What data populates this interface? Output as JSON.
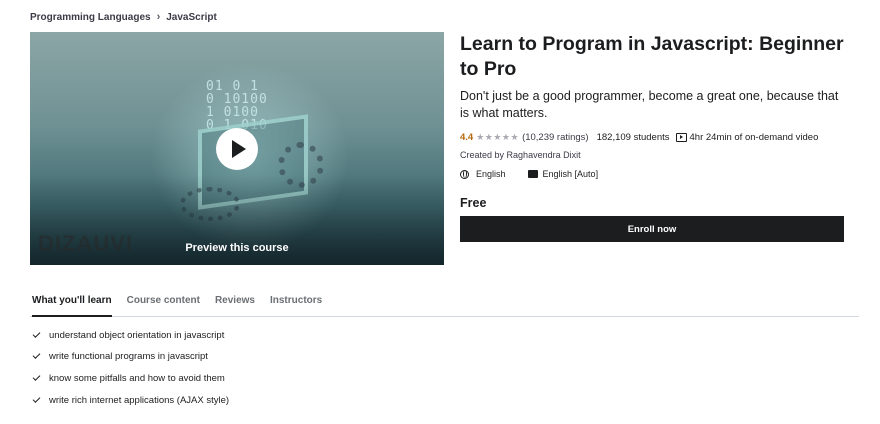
{
  "breadcrumb": {
    "items": [
      "Programming Languages",
      "JavaScript"
    ],
    "separator": "›"
  },
  "preview": {
    "caption": "Preview this course",
    "watermark": "DIZAUVI",
    "code_bits": [
      "01 0 1",
      "0 10100",
      "1 0100",
      "0 1 010"
    ]
  },
  "course": {
    "title": "Learn to Program in Javascript: Beginner to Pro",
    "subtitle": "Don't just be a good programmer, become a great one, because that is what matters.",
    "rating": "4.4",
    "stars": "★★★★★",
    "rating_count": "(10,239 ratings)",
    "students": "182,109 students",
    "duration": "4hr 24min of on-demand video",
    "created_by_prefix": "Created by",
    "instructor": "Raghavendra Dixit",
    "language": "English",
    "captions": "English [Auto]",
    "price": "Free",
    "enroll_label": "Enroll now"
  },
  "tabs": [
    "What you'll learn",
    "Course content",
    "Reviews",
    "Instructors"
  ],
  "learn_items": [
    "understand object orientation in javascript",
    "write functional programs in javascript",
    "know some pitfalls and how to avoid them",
    "write rich internet applications (AJAX style)"
  ],
  "colors": {
    "text": "#1c1d1f",
    "rating": "#b4690e",
    "button_bg": "#1c1d1f",
    "divider": "#d1d7dc"
  }
}
